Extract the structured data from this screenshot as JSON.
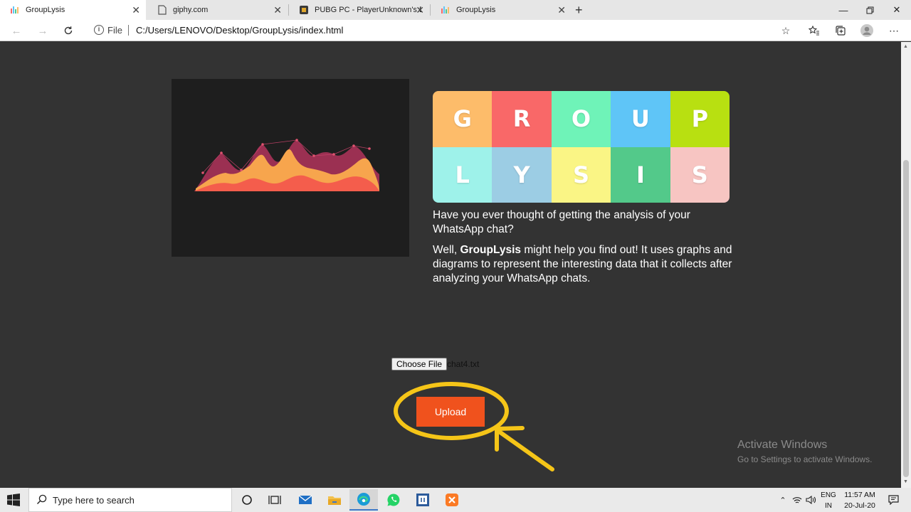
{
  "browser": {
    "tabs": [
      {
        "title": "GroupLysis",
        "active": true
      },
      {
        "title": "giphy.com",
        "active": false
      },
      {
        "title": "PUBG PC - PlayerUnknown's Battl",
        "active": false
      },
      {
        "title": "GroupLysis",
        "active": false
      }
    ],
    "scheme": "File",
    "url": "C:/Users/LENOVO/Desktop/GroupLysis/index.html"
  },
  "page": {
    "logo_letters": [
      {
        "letter": "G",
        "color": "#fdbc6a"
      },
      {
        "letter": "R",
        "color": "#f96868"
      },
      {
        "letter": "O",
        "color": "#6ff3b8"
      },
      {
        "letter": "U",
        "color": "#5fc5f7"
      },
      {
        "letter": "P",
        "color": "#b8e011"
      },
      {
        "letter": "L",
        "color": "#9ef2ea"
      },
      {
        "letter": "Y",
        "color": "#9ccde4"
      },
      {
        "letter": "S",
        "color": "#faf585"
      },
      {
        "letter": "I",
        "color": "#53c98a"
      },
      {
        "letter": "S",
        "color": "#f7c5c2"
      }
    ],
    "question": "Have you ever thought of getting the analysis of your WhatsApp chat?",
    "answer_prefix": "Well, ",
    "brand": "GroupLysis",
    "answer_suffix": " might help you find out! It uses graphs and diagrams to represent the interesting data that it collects after analyzing your WhatsApp chats.",
    "choose_file_label": "Choose File",
    "file_name": "chat4.txt",
    "upload_label": "Upload",
    "accent_color": "#f0521d",
    "annotation_color": "#f5c518"
  },
  "watermark": {
    "title": "Activate Windows",
    "subtitle": "Go to Settings to activate Windows."
  },
  "taskbar": {
    "search_placeholder": "Type here to search",
    "lang_line1": "ENG",
    "lang_line2": "IN",
    "time": "11:57 AM",
    "date": "20-Jul-20"
  }
}
